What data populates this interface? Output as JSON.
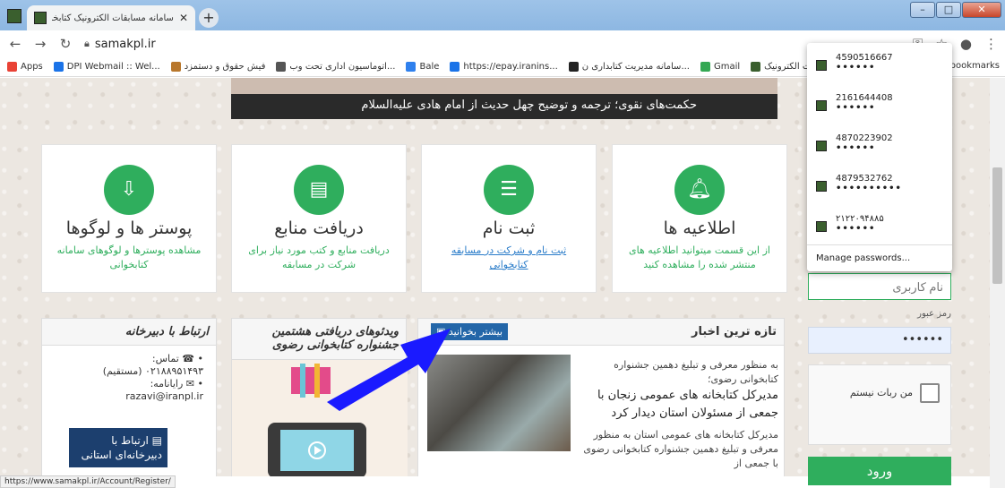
{
  "browser": {
    "tab_title": "سامانه مسابقات الکترونیک کتابخوانی",
    "url": "samakpl.ir",
    "status_url": "https://www.samakpl.ir/Account/Register/",
    "bookmarks": [
      {
        "label": "Apps",
        "color": "#e94235"
      },
      {
        "label": "DPI Webmail :: Wel...",
        "color": "#1a73e8"
      },
      {
        "label": "فیش حقوق و دستمزد",
        "color": "#b8772c"
      },
      {
        "label": "اتوماسیون اداری تحت وب...",
        "color": "#555555"
      },
      {
        "label": "Bale",
        "color": "#2f80ed"
      },
      {
        "label": "https://epay.iranins...",
        "color": "#1a73e8"
      },
      {
        "label": "سامانه مدیریت کتابداری ن...",
        "color": "#222222"
      },
      {
        "label": "Gmail",
        "color": "#34a853"
      },
      {
        "label": "سامانه مسابقات الکترونیک...",
        "color": "#3a5f2e"
      }
    ],
    "other_bookmarks": "r bookmarks"
  },
  "banner": {
    "caption": "حکمت‌های نقوی؛ ترجمه و توضیح چهل حدیث از امام هادی علیه‌السلام"
  },
  "cards": [
    {
      "title": "اطلاعیه ها",
      "desc": "از این قسمت میتوانید اطلاعیه های منتشر شده را مشاهده کنید",
      "icon": "bell-icon"
    },
    {
      "title": "ثبت نام",
      "desc": "ثبت نام و شرکت در مسابقه کتابخوانی",
      "icon": "register-icon"
    },
    {
      "title": "دریافت منابع",
      "desc": "دریافت منابع و کتب مورد نیاز برای شرکت در مسابقه",
      "icon": "books-icon"
    },
    {
      "title": "پوستر ها و لوگوها",
      "desc": "مشاهده پوسترها و لوگوهای سامانه کتابخوانی",
      "icon": "download-icon"
    }
  ],
  "news": {
    "heading": "تازه ترین اخبار",
    "more_label": "بیشتر بخوانید",
    "intro": "به منظور معرفی و تبلیغ دهمین جشنواره کتابخوانی رضوی؛",
    "headline": "مدیرکل کتابخانه های عمومی زنجان با جمعی از مسئولان استان دیدار کرد",
    "body": "مدیرکل کتابخانه های عمومی استان به منظور معرفی و تبلیغ دهمین جشنواره کتابخوانی رضوی با جمعی از"
  },
  "videos": {
    "heading": "ویدئوهای دریافتی هشتمین جشنواره کتابخوانی رضوی"
  },
  "contact": {
    "heading": "ارتباط با دبیرخانه",
    "phone_label": "تماس:",
    "phone": "۰۲۱۸۸۹۵۱۴۹۳ (مستقیم)",
    "email_label": "رایانامه:",
    "email": "razavi@iranpl.ir",
    "button": "ارتباط با دبیرخانه‌ای استانی"
  },
  "login": {
    "username_placeholder": "نام کاربری",
    "password_label": "رمز عبور",
    "password_value": "••••••",
    "captcha_label": "من ربات نیستم",
    "submit": "ورود"
  },
  "saved_passwords": {
    "items": [
      {
        "user": "4590516667",
        "pass": "••••••"
      },
      {
        "user": "2161644408",
        "pass": "••••••"
      },
      {
        "user": "4870223902",
        "pass": "••••••"
      },
      {
        "user": "4879532762",
        "pass": "••••••••••"
      },
      {
        "user": "۲۱۲۲۰۹۴۸۸۵",
        "pass": "••••••"
      }
    ],
    "manage": "Manage passwords..."
  }
}
